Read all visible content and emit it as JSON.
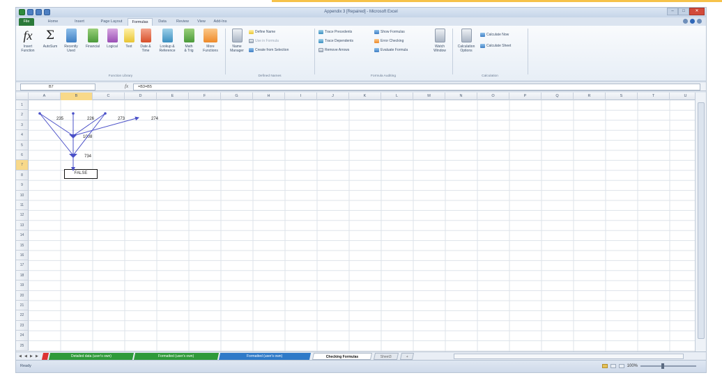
{
  "window": {
    "title": "Appendix 3 [Repaired] - Microsoft Excel",
    "minimize": "–",
    "restore": "□",
    "close": "✕"
  },
  "tabs": [
    {
      "label": "File"
    },
    {
      "label": "Home"
    },
    {
      "label": "Insert"
    },
    {
      "label": "Page Layout"
    },
    {
      "label": "Formulas"
    },
    {
      "label": "Data"
    },
    {
      "label": "Review"
    },
    {
      "label": "View"
    },
    {
      "label": "Add-Ins"
    }
  ],
  "ribbon": {
    "function_library": {
      "insert_function": [
        "Insert",
        "Function"
      ],
      "autosum": "AutoSum",
      "recently_used": [
        "Recently",
        "Used"
      ],
      "financial": "Financial",
      "logical": "Logical",
      "text": "Text",
      "date_time": [
        "Date &",
        "Time"
      ],
      "lookup": [
        "Lookup &",
        "Reference"
      ],
      "math": [
        "Math",
        "& Trig"
      ],
      "more": [
        "More",
        "Functions"
      ],
      "label": "Function Library"
    },
    "defined_names": {
      "name_manager": [
        "Name",
        "Manager"
      ],
      "define_name": "Define Name",
      "use_in_formula": "Use in Formula",
      "create_from_selection": "Create from Selection",
      "label": "Defined Names"
    },
    "formula_auditing": {
      "trace_precedents": "Trace Precedents",
      "trace_dependents": "Trace Dependents",
      "remove_arrows": "Remove Arrows",
      "show_formulas": "Show Formulas",
      "error_checking": "Error Checking",
      "evaluate_formula": "Evaluate Formula",
      "watch_window": [
        "Watch",
        "Window"
      ],
      "label": "Formula Auditing"
    },
    "calculation": {
      "calculation_options": [
        "Calculation",
        "Options"
      ],
      "calculate_now": "Calculate Now",
      "calculate_sheet": "Calculate Sheet",
      "label": "Calculation"
    }
  },
  "formula_bar": {
    "name_box": "B7",
    "fx": "fx",
    "formula": "=B3=B5"
  },
  "columns": [
    "A",
    "B",
    "C",
    "D",
    "E",
    "F",
    "G",
    "H",
    "I",
    "J",
    "K",
    "L",
    "M",
    "N",
    "O",
    "P",
    "Q",
    "R",
    "S",
    "T",
    "U"
  ],
  "rows": [
    "1",
    "2",
    "3",
    "4",
    "5",
    "6",
    "7",
    "8",
    "9",
    "10",
    "11",
    "12",
    "13",
    "14",
    "15",
    "16",
    "17",
    "18",
    "19",
    "20",
    "21",
    "22",
    "23",
    "24",
    "25"
  ],
  "cells": {
    "A1": "235",
    "B1": "226",
    "C1": "273",
    "D1": "274",
    "B3": "1008",
    "B5": "734",
    "B7": "FALSE"
  },
  "sheet_tabs": [
    {
      "label": "Detailed data (user's own)",
      "color": "#2f9a3a"
    },
    {
      "label": "Formatted (user's own)",
      "color": "#2f9a3a"
    },
    {
      "label": "Formatted (user's own)",
      "color": "#2f7ac8"
    },
    {
      "label": "Checking Formulas",
      "color": "#ffffff"
    },
    {
      "label": "Sheet3"
    }
  ],
  "status": {
    "ready": "Ready",
    "zoom": "100%"
  },
  "colors": {
    "accent_bar": "#f6c24a",
    "file_tab": "#2b7a3a",
    "trace_arrow": "#4a50c8",
    "selected_header": "#f8d98a"
  }
}
